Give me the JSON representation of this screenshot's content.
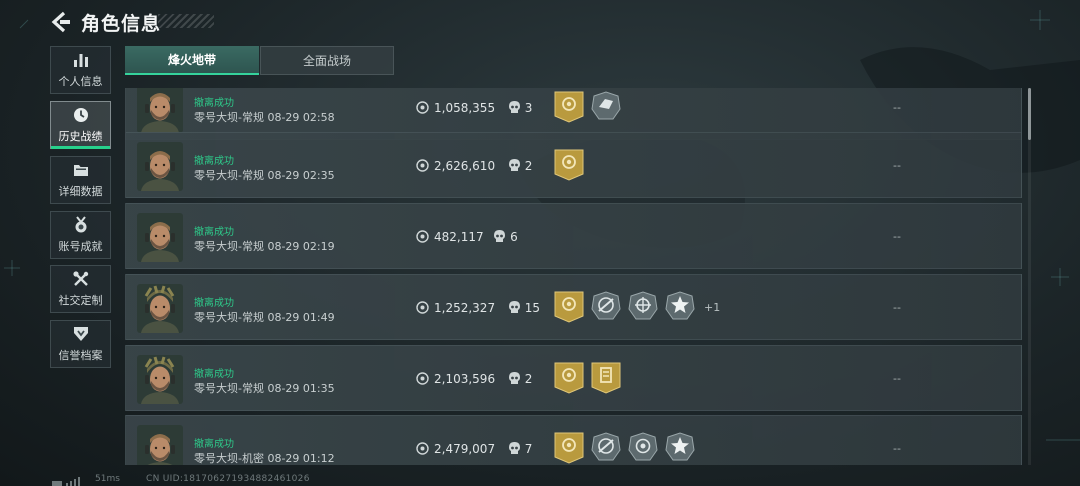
{
  "header": {
    "title": "角色信息"
  },
  "sidebar": {
    "items": [
      {
        "label": "个人信息",
        "icon": "bar-chart-icon"
      },
      {
        "label": "历史战绩",
        "icon": "clock-icon",
        "active": true
      },
      {
        "label": "详细数据",
        "icon": "folder-icon"
      },
      {
        "label": "账号成就",
        "icon": "medal-icon"
      },
      {
        "label": "社交定制",
        "icon": "tools-icon"
      },
      {
        "label": "信誉档案",
        "icon": "shield-badge-icon"
      }
    ]
  },
  "tabs": [
    {
      "label": "烽火地带",
      "active": true
    },
    {
      "label": "全面战场",
      "active": false
    }
  ],
  "records": [
    {
      "status": "撤离成功",
      "map": "零号大坝-常规 08-29 02:58",
      "value": "1,058,355",
      "kills": "3",
      "badges": [
        "gold-coin-badge",
        "silver-hand-badge"
      ],
      "extra": "",
      "result": "--",
      "avatar": "soldier-portrait"
    },
    {
      "status": "撤离成功",
      "map": "零号大坝-常规 08-29 02:35",
      "value": "2,626,610",
      "kills": "2",
      "badges": [
        "gold-coin-badge"
      ],
      "extra": "",
      "result": "--",
      "avatar": "soldier-portrait"
    },
    {
      "status": "撤离成功",
      "map": "零号大坝-常规 08-29 02:19",
      "value": "482,117",
      "kills": "6",
      "badges": [],
      "extra": "",
      "result": "--",
      "avatar": "soldier-portrait"
    },
    {
      "status": "撤离成功",
      "map": "零号大坝-常规 08-29 01:49",
      "value": "1,252,327",
      "kills": "15",
      "badges": [
        "gold-coin-badge",
        "silver-rifle-badge",
        "silver-crosshair-badge",
        "silver-star-badge"
      ],
      "extra": "+1",
      "result": "--",
      "avatar": "helmet-soldier-portrait"
    },
    {
      "status": "撤离成功",
      "map": "零号大坝-常规 08-29 01:35",
      "value": "2,103,596",
      "kills": "2",
      "badges": [
        "gold-coin-badge",
        "gold-card-badge"
      ],
      "extra": "",
      "result": "--",
      "avatar": "helmet-soldier-portrait"
    },
    {
      "status": "撤离成功",
      "map": "零号大坝-机密 08-29 01:12",
      "value": "2,479,007",
      "kills": "7",
      "badges": [
        "gold-coin-badge",
        "silver-rifle-badge",
        "silver-target-badge",
        "silver-star-badge"
      ],
      "extra": "",
      "result": "--",
      "avatar": "soldier-portrait"
    }
  ],
  "footer": {
    "ping": "51ms",
    "uid": "CN UID:181706271934882461026"
  },
  "colors": {
    "accent": "#2ec98a",
    "tab_active": "#3a6a62",
    "gold_badge": "#b99a3e",
    "silver_badge": "#5d6a6e"
  }
}
